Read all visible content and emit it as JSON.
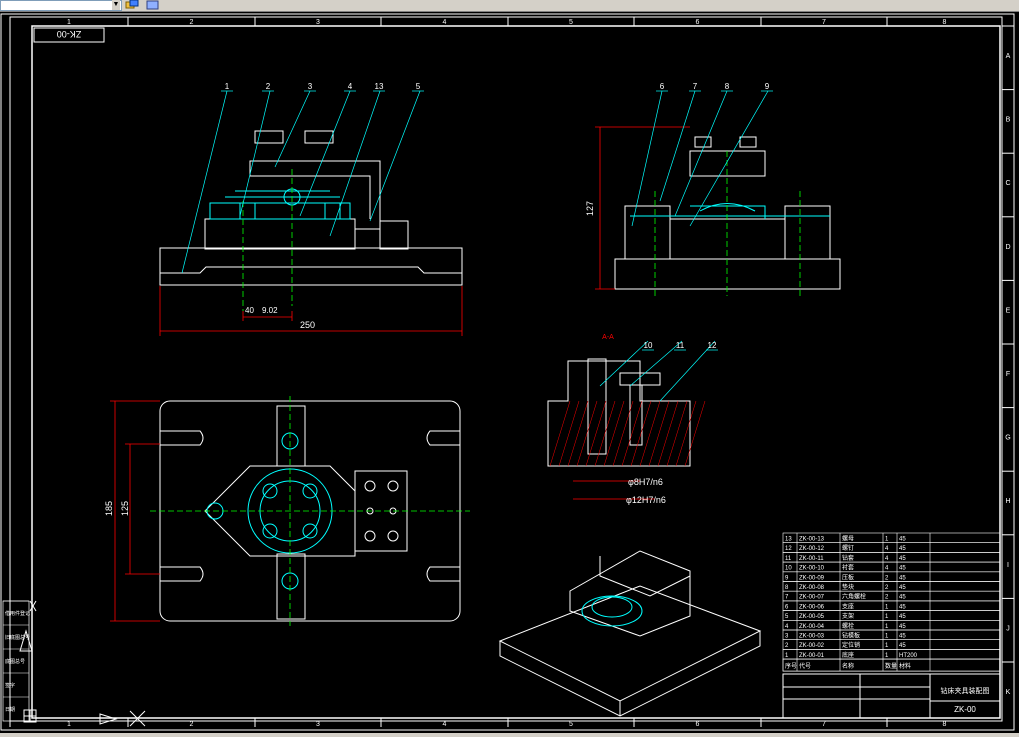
{
  "toolbar": {
    "layer_value": "",
    "icon1": "layer-state-icon",
    "icon2": "layer-previous-icon"
  },
  "border": {
    "columns": [
      "1",
      "2",
      "3",
      "4",
      "5",
      "6",
      "7",
      "8"
    ],
    "rows": [
      "A",
      "B",
      "C",
      "D",
      "E",
      "F",
      "G",
      "H",
      "I",
      "J",
      "K"
    ]
  },
  "drawing_no_box": "ZK-00",
  "dims": {
    "d250": "250",
    "d40": "40",
    "d902": "9.02",
    "d127": "127",
    "d185": "185",
    "d125": "125",
    "fit1": "φ8H7/n6",
    "fit2": "φ12H7/n6"
  },
  "balloons": [
    "1",
    "2",
    "3",
    "4",
    "13",
    "5",
    "6",
    "7",
    "8",
    "9",
    "10",
    "11",
    "12"
  ],
  "section_mark": "A-A",
  "bom": {
    "rows": [
      {
        "no": "13",
        "code": "ZK-00-13",
        "name": "螺母",
        "qty": "1",
        "mat": "45"
      },
      {
        "no": "12",
        "code": "ZK-00-12",
        "name": "螺钉",
        "qty": "4",
        "mat": "45"
      },
      {
        "no": "11",
        "code": "ZK-00-11",
        "name": "钻套",
        "qty": "4",
        "mat": "45"
      },
      {
        "no": "10",
        "code": "ZK-00-10",
        "name": "衬套",
        "qty": "4",
        "mat": "45"
      },
      {
        "no": "9",
        "code": "ZK-00-09",
        "name": "压板",
        "qty": "2",
        "mat": "45"
      },
      {
        "no": "8",
        "code": "ZK-00-08",
        "name": "垫块",
        "qty": "2",
        "mat": "45"
      },
      {
        "no": "7",
        "code": "ZK-00-07",
        "name": "六角螺栓",
        "qty": "2",
        "mat": "45"
      },
      {
        "no": "6",
        "code": "ZK-00-06",
        "name": "支座",
        "qty": "1",
        "mat": "45"
      },
      {
        "no": "5",
        "code": "ZK-00-05",
        "name": "支架",
        "qty": "1",
        "mat": "45"
      },
      {
        "no": "4",
        "code": "ZK-00-04",
        "name": "螺栓",
        "qty": "1",
        "mat": "45"
      },
      {
        "no": "3",
        "code": "ZK-00-03",
        "name": "钻模板",
        "qty": "1",
        "mat": "45"
      },
      {
        "no": "2",
        "code": "ZK-00-02",
        "name": "定位销",
        "qty": "1",
        "mat": "45"
      },
      {
        "no": "1",
        "code": "ZK-00-01",
        "name": "底座",
        "qty": "1",
        "mat": "HT200"
      }
    ],
    "header": [
      "序号",
      "代号",
      "名称",
      "数量",
      "材料"
    ]
  },
  "title_block": {
    "title": "钻床夹具装配图",
    "code": "ZK-00"
  },
  "left_strip": [
    "借用件登记",
    "旧底图总号",
    "底图总号",
    "签字",
    "日期"
  ],
  "colors": {
    "outline": "#ffffff",
    "cyan": "#00ffff",
    "green": "#00ff00",
    "red": "#ff0000",
    "yellow": "#ffff00"
  }
}
